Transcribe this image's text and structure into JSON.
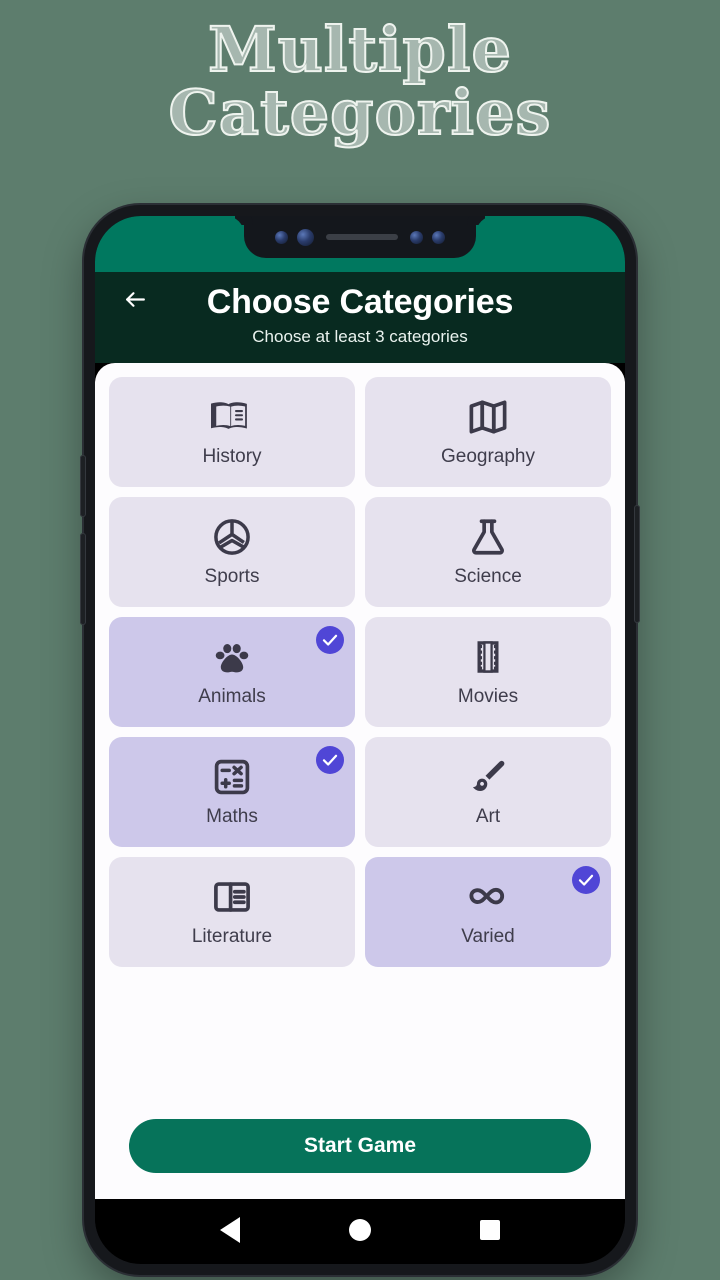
{
  "promo": {
    "line1": "Multiple",
    "line2": "Categories"
  },
  "colors": {
    "page_background": "#5d7d6d",
    "status_bar": "#00785f",
    "app_bar": "#082a20",
    "sheet": "#fdfcfe",
    "card": "#e6e2ee",
    "card_selected": "#cdc8ea",
    "check_badge": "#5046d6",
    "start_button": "#06735a",
    "icon": "#3c3a4a"
  },
  "appbar": {
    "back_icon": "arrow-back-icon",
    "title": "Choose Categories",
    "subtitle": "Choose at least 3 categories"
  },
  "categories": [
    {
      "label": "History",
      "icon": "open-book-icon",
      "selected": false
    },
    {
      "label": "Geography",
      "icon": "map-icon",
      "selected": false
    },
    {
      "label": "Sports",
      "icon": "sports-ball-icon",
      "selected": false
    },
    {
      "label": "Science",
      "icon": "flask-icon",
      "selected": false
    },
    {
      "label": "Animals",
      "icon": "paw-print-icon",
      "selected": true
    },
    {
      "label": "Movies",
      "icon": "film-strip-icon",
      "selected": false
    },
    {
      "label": "Maths",
      "icon": "calculator-icon",
      "selected": true
    },
    {
      "label": "Art",
      "icon": "paint-brush-icon",
      "selected": false
    },
    {
      "label": "Literature",
      "icon": "reader-mode-icon",
      "selected": false
    },
    {
      "label": "Varied",
      "icon": "infinity-icon",
      "selected": true
    }
  ],
  "footer": {
    "start_label": "Start Game"
  },
  "navbar": {
    "back": "nav-back-icon",
    "home": "nav-home-icon",
    "recents": "nav-recents-icon"
  }
}
